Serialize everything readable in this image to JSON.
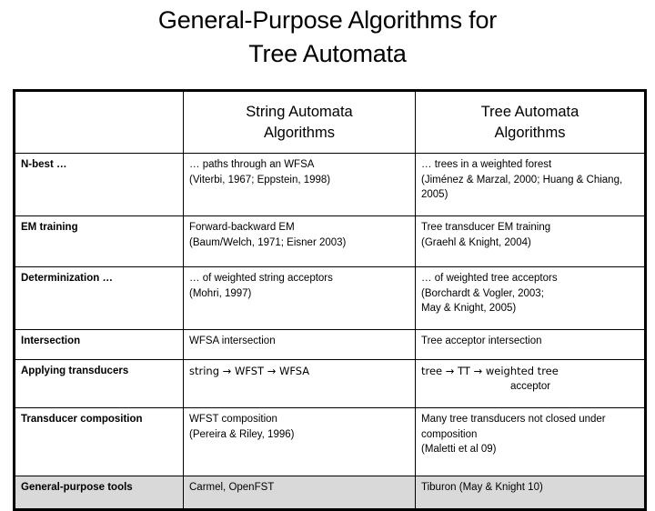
{
  "slide": {
    "title_line1": "General-Purpose Algorithms for",
    "title_line2": "Tree Automata"
  },
  "table": {
    "headers": {
      "col0": "",
      "col1_line1": "String Automata",
      "col1_line2": "Algorithms",
      "col2_line1": "Tree Automata",
      "col2_line2": "Algorithms"
    },
    "rows": [
      {
        "label": "N-best …",
        "string_lines": [
          "… paths through an WFSA",
          "(Viterbi, 1967; Eppstein, 1998)"
        ],
        "tree_lines": [
          "… trees in a weighted forest",
          "(Jiménez & Marzal, 2000;  Huang & Chiang, 2005)"
        ]
      },
      {
        "label": "EM training",
        "string_lines": [
          "Forward-backward EM",
          "(Baum/Welch, 1971; Eisner 2003)"
        ],
        "tree_lines": [
          "Tree transducer EM training",
          "(Graehl & Knight, 2004)"
        ]
      },
      {
        "label": "Determinization …",
        "string_lines": [
          "… of weighted string acceptors",
          "(Mohri, 1997)"
        ],
        "tree_lines": [
          "… of weighted tree acceptors",
          "(Borchardt & Vogler, 2003;",
          "May & Knight, 2005)"
        ]
      },
      {
        "label": "Intersection",
        "string_lines": [
          "WFSA intersection"
        ],
        "tree_lines": [
          "Tree acceptor intersection"
        ]
      },
      {
        "label": "Applying transducers",
        "string_lines": [
          "string → WFST → WFSA"
        ],
        "tree_lines": [
          "tree → TT → weighted tree",
          "acceptor"
        ]
      },
      {
        "label": "Transducer composition",
        "string_lines": [
          "WFST composition",
          "(Pereira & Riley, 1996)"
        ],
        "tree_lines": [
          "Many tree transducers not closed under composition",
          "(Maletti et al 09)"
        ]
      },
      {
        "label": "General-purpose tools",
        "string_lines": [
          "Carmel, OpenFST"
        ],
        "tree_lines": [
          "Tiburon (May & Knight 10)"
        ]
      }
    ]
  },
  "colors": {
    "background": "#ffffff",
    "text": "#000000",
    "border": "#000000",
    "shaded_row": "#d9d9d9"
  }
}
